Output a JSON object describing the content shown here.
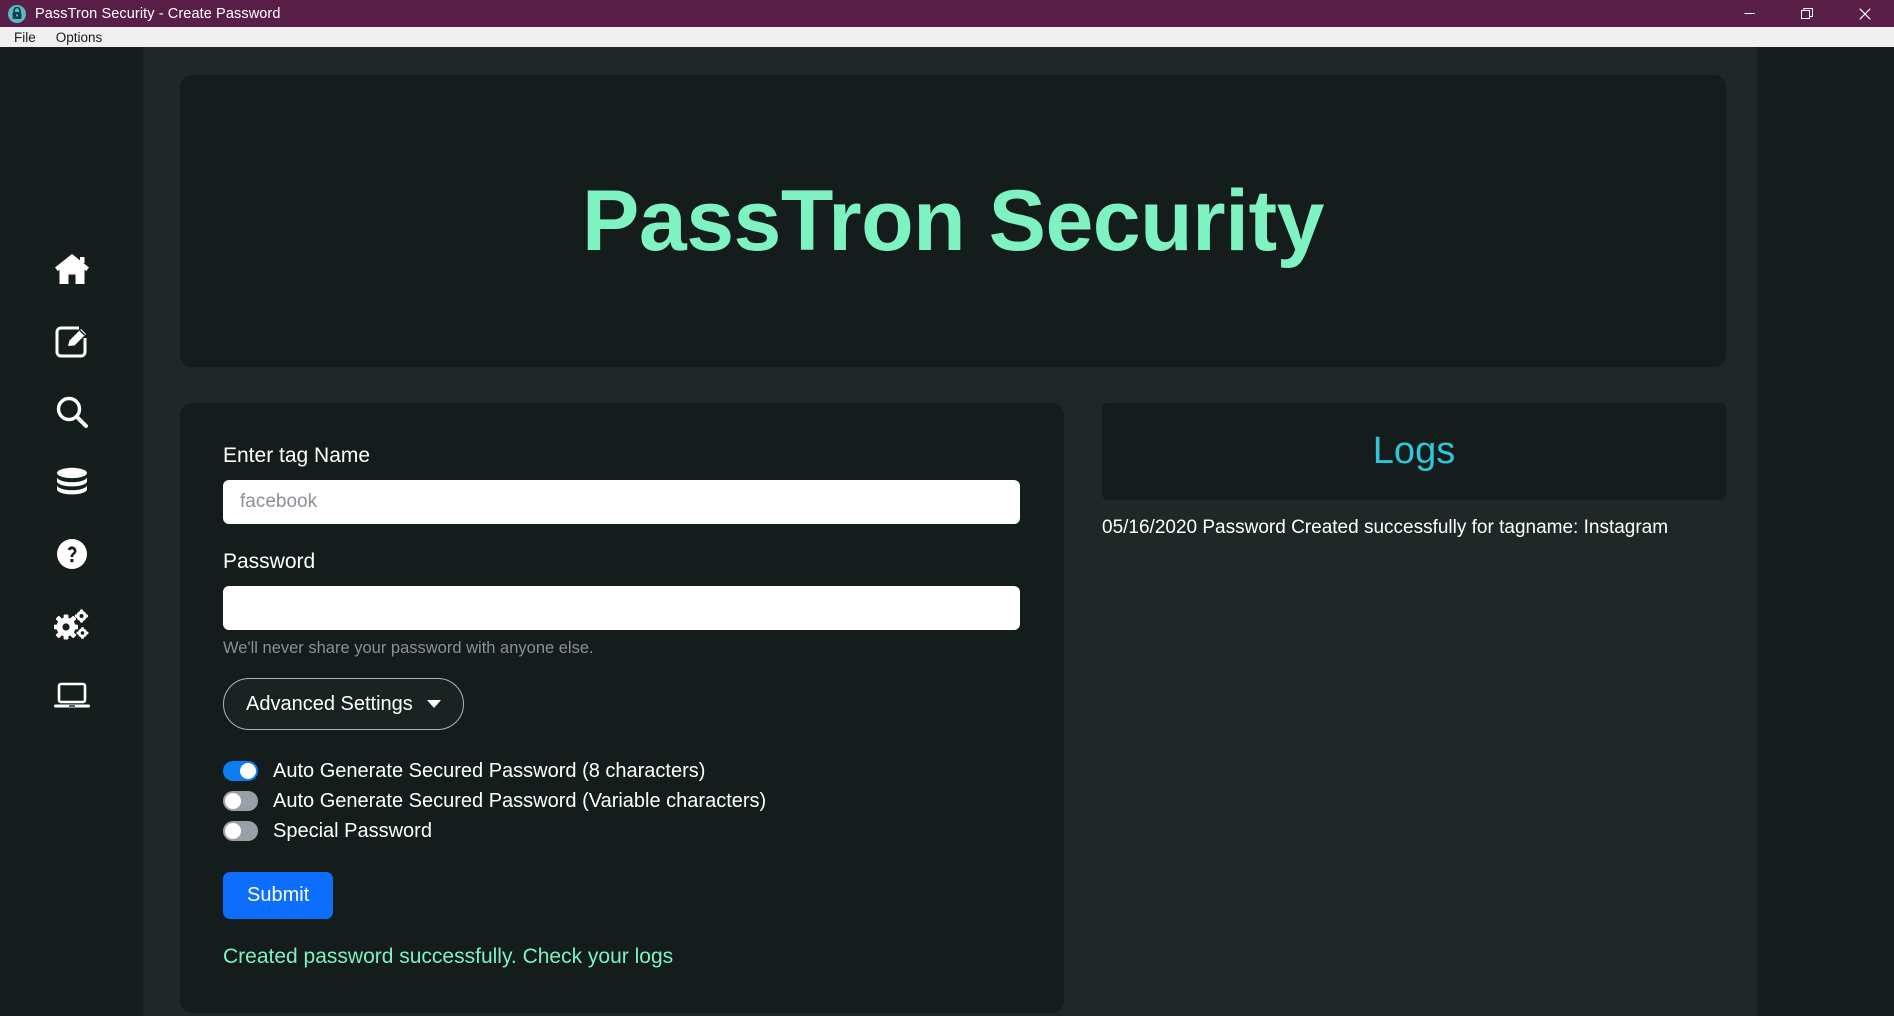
{
  "window": {
    "title": "PassTron Security - Create Password",
    "app_icon": "lock-icon",
    "controls": {
      "minimize": "minimize-icon",
      "restore": "restore-icon",
      "close": "close-icon"
    }
  },
  "menubar": {
    "items": [
      {
        "label": "File"
      },
      {
        "label": "Options"
      }
    ]
  },
  "sidebar": {
    "items": [
      {
        "icon": "home-icon",
        "name": "home"
      },
      {
        "icon": "edit-square-icon",
        "name": "create-password"
      },
      {
        "icon": "search-icon",
        "name": "search"
      },
      {
        "icon": "database-icon",
        "name": "database"
      },
      {
        "icon": "help-circle-icon",
        "name": "help"
      },
      {
        "icon": "cogs-icon",
        "name": "settings"
      },
      {
        "icon": "laptop-icon",
        "name": "device"
      }
    ]
  },
  "banner": {
    "title": "PassTron Security"
  },
  "form": {
    "tag_name_label": "Enter tag Name",
    "tag_name_value": "",
    "tag_name_placeholder": "facebook",
    "password_label": "Password",
    "password_value": "",
    "password_placeholder": "",
    "password_help": "We'll never share your password with anyone else.",
    "advanced_settings_label": "Advanced Settings",
    "toggles": [
      {
        "label": "Auto Generate Secured Password (8 characters)",
        "on": true
      },
      {
        "label": "Auto Generate Secured Password (Variable characters)",
        "on": false
      },
      {
        "label": "Special Password",
        "on": false
      }
    ],
    "submit_label": "Submit",
    "status_message": "Created password successfully. Check your logs"
  },
  "logs": {
    "title": "Logs",
    "entries": [
      "05/16/2020 Password Created successfully for tagname: Instagram"
    ]
  },
  "colors": {
    "titlebar": "#5a1f48",
    "accent_mint": "#7ef2c0",
    "accent_cyan": "#2ec6d8",
    "primary_blue": "#0d6efd",
    "toggle_on": "#0d7ef0",
    "card_bg": "#151c1c",
    "sidebar_bg": "#161d1d",
    "main_bg": "#1f2727"
  }
}
